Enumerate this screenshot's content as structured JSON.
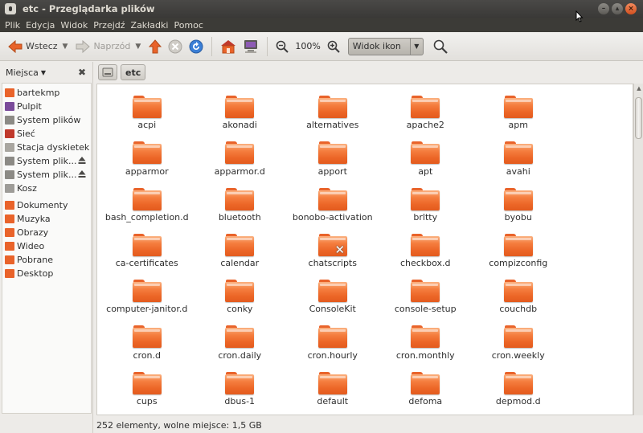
{
  "window": {
    "title": "etc - Przeglądarka plików",
    "controls": [
      "minimize",
      "maximize",
      "close"
    ]
  },
  "menubar": [
    "Plik",
    "Edycja",
    "Widok",
    "Przejdź",
    "Zakładki",
    "Pomoc"
  ],
  "toolbar": {
    "back_label": "Wstecz",
    "forward_label": "Naprzód",
    "zoom_level": "100%",
    "view_mode": "Widok ikon"
  },
  "sidebar": {
    "header": "Miejsca",
    "items": [
      {
        "label": "bartekmp",
        "icon": "home-folder-icon",
        "color": "#e9632a"
      },
      {
        "label": "Pulpit",
        "icon": "desktop-icon",
        "color": "#7a4b9a"
      },
      {
        "label": "System plików",
        "icon": "filesystem-icon",
        "color": "#8c8a85"
      },
      {
        "label": "Sieć",
        "icon": "network-icon",
        "color": "#c0392b"
      },
      {
        "label": "Stacja dyskietek",
        "icon": "floppy-icon",
        "color": "#a9a6a0"
      },
      {
        "label": "System plik...",
        "icon": "drive-icon",
        "color": "#8c8a85",
        "eject": true
      },
      {
        "label": "System plik...",
        "icon": "drive-icon",
        "color": "#8c8a85",
        "eject": true
      },
      {
        "label": "Kosz",
        "icon": "trash-icon",
        "color": "#9e9c98"
      },
      {
        "label": "Dokumenty",
        "icon": "documents-folder-icon",
        "color": "#e9632a"
      },
      {
        "label": "Muzyka",
        "icon": "music-folder-icon",
        "color": "#e9632a"
      },
      {
        "label": "Obrazy",
        "icon": "pictures-folder-icon",
        "color": "#e9632a"
      },
      {
        "label": "Wideo",
        "icon": "videos-folder-icon",
        "color": "#e9632a"
      },
      {
        "label": "Pobrane",
        "icon": "downloads-folder-icon",
        "color": "#e9632a"
      },
      {
        "label": "Desktop",
        "icon": "folder-icon",
        "color": "#e9632a"
      }
    ]
  },
  "pathbar": {
    "current": "etc"
  },
  "files": [
    {
      "name": "acpi"
    },
    {
      "name": "akonadi"
    },
    {
      "name": "alternatives"
    },
    {
      "name": "apache2"
    },
    {
      "name": "apm"
    },
    {
      "name": "apparmor"
    },
    {
      "name": "apparmor.d"
    },
    {
      "name": "apport"
    },
    {
      "name": "apt"
    },
    {
      "name": "avahi"
    },
    {
      "name": "bash_completion.d"
    },
    {
      "name": "bluetooth"
    },
    {
      "name": "bonobo-activation"
    },
    {
      "name": "brltty"
    },
    {
      "name": "byobu"
    },
    {
      "name": "ca-certificates"
    },
    {
      "name": "calendar"
    },
    {
      "name": "chatscripts",
      "restricted": true
    },
    {
      "name": "checkbox.d"
    },
    {
      "name": "compizconfig"
    },
    {
      "name": "computer-janitor.d"
    },
    {
      "name": "conky"
    },
    {
      "name": "ConsoleKit"
    },
    {
      "name": "console-setup"
    },
    {
      "name": "couchdb"
    },
    {
      "name": "cron.d"
    },
    {
      "name": "cron.daily"
    },
    {
      "name": "cron.hourly"
    },
    {
      "name": "cron.monthly"
    },
    {
      "name": "cron.weekly"
    },
    {
      "name": "cups"
    },
    {
      "name": "dbus-1"
    },
    {
      "name": "default"
    },
    {
      "name": "defoma"
    },
    {
      "name": "depmod.d"
    }
  ],
  "statusbar": {
    "text": "252 elementy, wolne miejsce: 1,5 GB"
  }
}
